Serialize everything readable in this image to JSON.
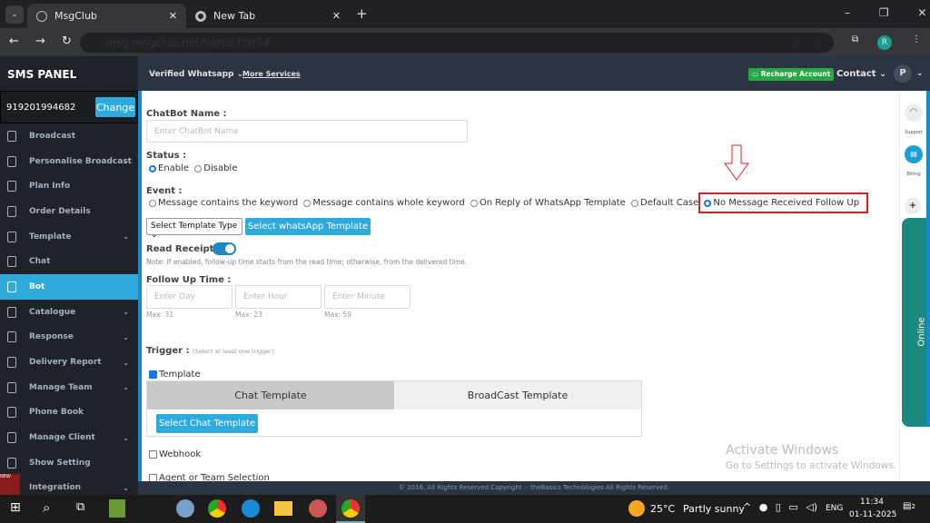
{
  "browser": {
    "tabs": [
      {
        "title": "MsgClub"
      },
      {
        "title": "New Tab"
      }
    ],
    "url": "msg.msgclub.net/home.html#",
    "profile": "R"
  },
  "sidebar": {
    "title": "SMS PANEL",
    "number": "919201994682",
    "change_label": "Change",
    "items": [
      {
        "label": "Broadcast",
        "chev": false
      },
      {
        "label": "Personalise Broadcast",
        "chev": true
      },
      {
        "label": "Plan Info",
        "chev": false
      },
      {
        "label": "Order Details",
        "chev": false
      },
      {
        "label": "Template",
        "chev": true
      },
      {
        "label": "Chat",
        "chev": false
      },
      {
        "label": "Bot",
        "chev": false,
        "active": true
      },
      {
        "label": "Catalogue",
        "chev": true
      },
      {
        "label": "Response",
        "chev": true
      },
      {
        "label": "Delivery Report",
        "chev": true
      },
      {
        "label": "Manage Team",
        "chev": true
      },
      {
        "label": "Phone Book",
        "chev": false
      },
      {
        "label": "Manage Client",
        "chev": true
      },
      {
        "label": "Show Setting",
        "chev": false
      },
      {
        "label": "Integration",
        "chev": true
      }
    ],
    "new_badge": "NEW"
  },
  "header": {
    "verified": "Verified Whatsapp",
    "more": "More Services",
    "recharge": "Recharge Account",
    "contact": "Contact",
    "avatar": "P"
  },
  "form": {
    "chatbot_label": "ChatBot Name :",
    "chatbot_placeholder": "Enter ChatBot Name",
    "status_label": "Status :",
    "status_options": [
      "Enable",
      "Disable"
    ],
    "event_label": "Event :",
    "event_options": [
      "Message contains the keyword",
      "Message contains whole keyword",
      "On Reply of WhatsApp Template",
      "Default Case",
      "No Message Received Follow Up"
    ],
    "template_type": "Select Template Type",
    "select_wa": "Select whatsApp Template",
    "read_receipt": "Read Receipt :",
    "read_receipt_on": true,
    "note": "Note: If enabled, follow-up time starts from the read time; otherwise, from the delivered time.",
    "followup_label": "Follow Up Time :",
    "followup": [
      {
        "ph": "Enter Day",
        "max": "Max: 31"
      },
      {
        "ph": "Enter Hour",
        "max": "Max: 23"
      },
      {
        "ph": "Enter Minute",
        "max": "Max: 59"
      }
    ],
    "trigger_label": "Trigger :",
    "trigger_hint": "(Select at least one trigger)",
    "template_cb": "Template",
    "tab_chat": "Chat Template",
    "tab_broadcast": "BroadCast Template",
    "select_chat": "Select Chat Template",
    "webhook": "Webhook",
    "agent": "Agent or Team Selection"
  },
  "rail": {
    "support": "Support",
    "billing": "Billing",
    "online": "Online"
  },
  "footer": "© 2016, All Rights Reserved Copyright :- theBasics Technologies All Rights Reserved.",
  "watermark": {
    "title": "Activate Windows",
    "sub": "Go to Settings to activate Windows."
  },
  "taskbar": {
    "temp": "25°C",
    "weather": "Partly sunny",
    "lang": "ENG",
    "time": "11:34",
    "date": "01-11-2025",
    "notif": "2"
  }
}
